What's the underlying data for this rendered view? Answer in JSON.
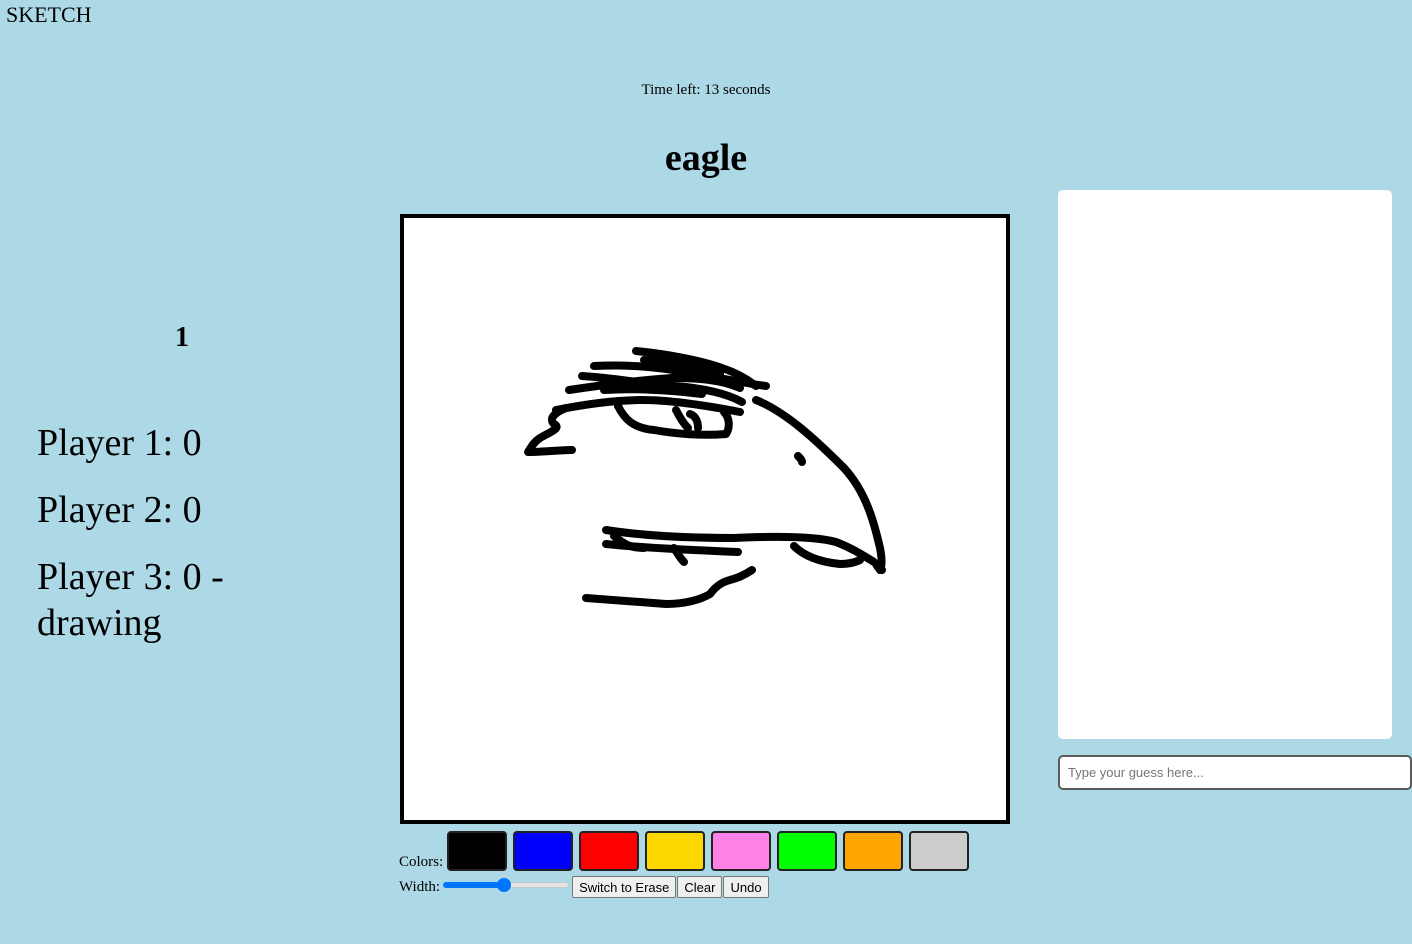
{
  "app": {
    "title": "SKETCH"
  },
  "timer": {
    "text": "Time left: 13 seconds"
  },
  "word": {
    "text": "eagle"
  },
  "round": {
    "number": "1"
  },
  "players": [
    {
      "label": "Player 1: 0"
    },
    {
      "label": "Player 2: 0"
    },
    {
      "label": "Player 3: 0 - drawing"
    }
  ],
  "canvas": {
    "background": "#ffffff",
    "stroke_color": "#000000"
  },
  "tools": {
    "colors_label": "Colors:",
    "colors": [
      {
        "name": "black",
        "hex": "#000000"
      },
      {
        "name": "blue",
        "hex": "#0000ff"
      },
      {
        "name": "red",
        "hex": "#ff0000"
      },
      {
        "name": "yellow",
        "hex": "#ffd700"
      },
      {
        "name": "pink",
        "hex": "#ff80e6"
      },
      {
        "name": "green",
        "hex": "#00ff00"
      },
      {
        "name": "orange",
        "hex": "#ffa500"
      },
      {
        "name": "gray",
        "hex": "#cccccc"
      }
    ],
    "width_label": "Width:",
    "width_level": 0.48,
    "erase_label": "Switch to Erase",
    "clear_label": "Clear",
    "undo_label": "Undo"
  },
  "chat": {
    "placeholder": "Type your guess here..."
  }
}
